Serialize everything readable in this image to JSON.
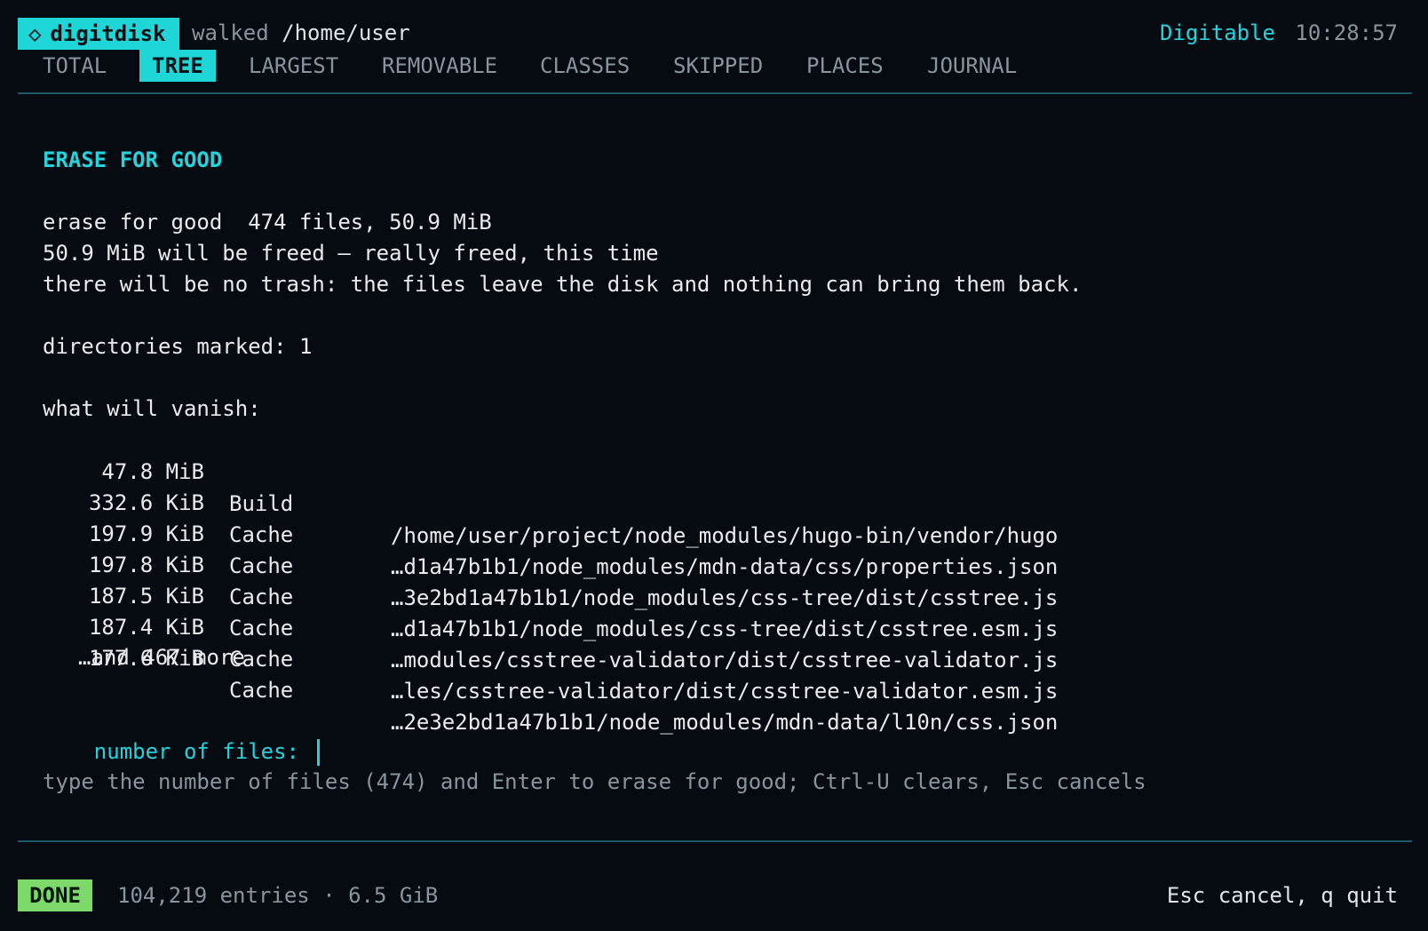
{
  "header": {
    "brand_icon": "diamond-icon",
    "brand_glyph": "◇",
    "brand_name": "digitdisk",
    "walked_label": "walked",
    "walked_path": "/home/user",
    "machine": "Digitable",
    "clock": "10:28:57"
  },
  "tabs": [
    {
      "label": "TOTAL",
      "active": false
    },
    {
      "label": "TREE",
      "active": true
    },
    {
      "label": "LARGEST",
      "active": false
    },
    {
      "label": "REMOVABLE",
      "active": false
    },
    {
      "label": "CLASSES",
      "active": false
    },
    {
      "label": "SKIPPED",
      "active": false
    },
    {
      "label": "PLACES",
      "active": false
    },
    {
      "label": "JOURNAL",
      "active": false
    }
  ],
  "dialog": {
    "title": "ERASE FOR GOOD",
    "summary": "erase for good  474 files, 50.9 MiB",
    "freed": "50.9 MiB will be freed — really freed, this time",
    "warning": "there will be no trash: the files leave the disk and nothing can bring them back.",
    "dirs_marked": "directories marked: 1",
    "vanish_label": "what will vanish:",
    "files": [
      {
        "size": "47.8 MiB",
        "class": "Build",
        "path": "/home/user/project/node_modules/hugo-bin/vendor/hugo"
      },
      {
        "size": "332.6 KiB",
        "class": "Cache",
        "path": "…d1a47b1b1/node_modules/mdn-data/css/properties.json"
      },
      {
        "size": "197.9 KiB",
        "class": "Cache",
        "path": "…3e2bd1a47b1b1/node_modules/css-tree/dist/csstree.js"
      },
      {
        "size": "197.8 KiB",
        "class": "Cache",
        "path": "…d1a47b1b1/node_modules/css-tree/dist/csstree.esm.js"
      },
      {
        "size": "187.5 KiB",
        "class": "Cache",
        "path": "…modules/csstree-validator/dist/csstree-validator.js"
      },
      {
        "size": "187.4 KiB",
        "class": "Cache",
        "path": "…les/csstree-validator/dist/csstree-validator.esm.js"
      },
      {
        "size": "177.6 KiB",
        "class": "Cache",
        "path": "…2e3e2bd1a47b1b1/node_modules/mdn-data/l10n/css.json"
      }
    ],
    "more": "…and 467 more",
    "prompt_label": "number of files:",
    "prompt_value": "",
    "hint": "type the number of files (474) and Enter to erase for good; Ctrl-U clears, Esc cancels"
  },
  "footer": {
    "status": "DONE",
    "stats": "104,219 entries · 6.5 GiB",
    "keys": "Esc cancel, q quit"
  },
  "colors": {
    "background": "#060b12",
    "accent": "#1ed6d6",
    "done": "#7dd96a",
    "muted": "#8a949c",
    "rule": "#1d5a66"
  }
}
